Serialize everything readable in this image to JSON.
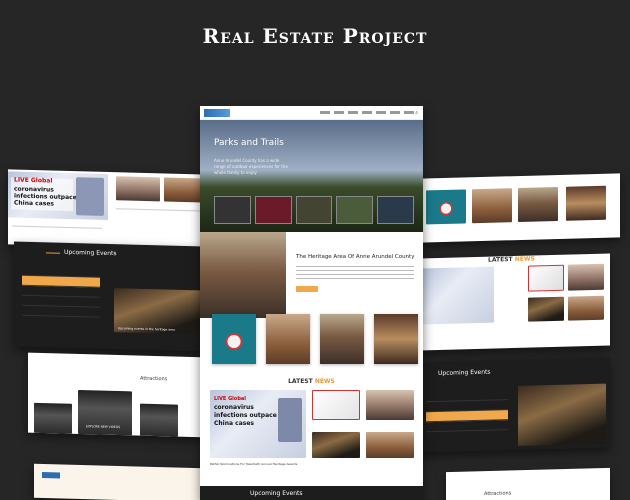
{
  "page_title": "Real Estate Project",
  "center_panel": {
    "hero_title": "Parks and Trails",
    "hero_text": "Anne Arundel County has a wide range of outdoor experiences for the whole family to enjoy",
    "section_title": "The Heritage Area Of Anne Arundel County",
    "latest_label": "LATEST",
    "news_label": "NEWS",
    "news_headline_left": "Pathin Nominations For Twentieth Annual Heritage Awards",
    "upcoming_events": "Upcoming Events",
    "news_card_screen": {
      "live": "LIVE Global",
      "line1": "coronavirus",
      "line2": "infections outpace",
      "line3": "China cases"
    }
  },
  "left_top_panel": {
    "news_card_screen": {
      "live": "LIVE Global",
      "line1": "coronavirus",
      "line2": "infections outpace",
      "line3": "China cases"
    }
  },
  "left_events_panel": {
    "title": "Upcoming Events",
    "caption": "Upcoming events in the heritage area"
  },
  "left_attractions_panel": {
    "title": "Attractions",
    "card_labels": [
      "EXPLORE NEW VIDEOS"
    ]
  },
  "right_latest_panel": {
    "latest_label": "LATEST",
    "news_label": "NEWS"
  },
  "right_events_panel": {
    "title": "Upcoming Events"
  },
  "right_attractions_panel": {
    "title": "Attractions"
  },
  "colors": {
    "background": "#262626",
    "accent": "#e49a3d",
    "dark_panel": "#1d1d1d"
  }
}
